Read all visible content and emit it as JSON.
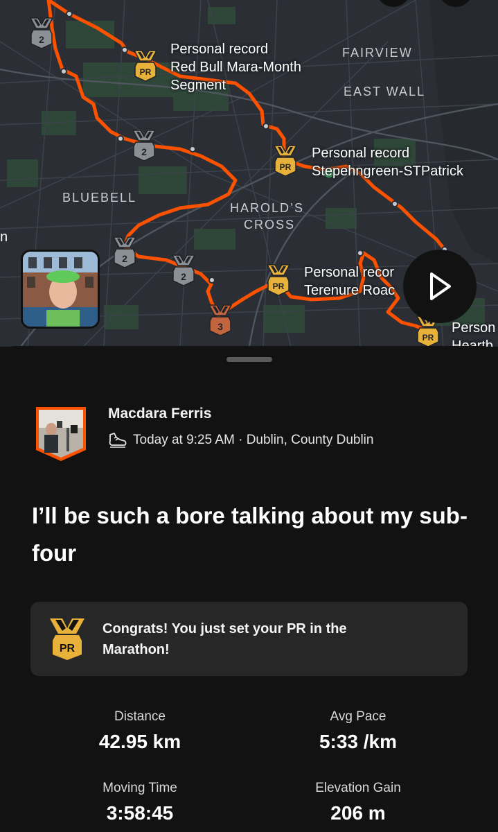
{
  "map": {
    "areas": [
      "FAIRVIEW",
      "EAST WALL",
      "BLUEBELL",
      "HAROLD’S",
      "CROSS",
      "n"
    ],
    "segments": [
      {
        "line1": "Personal record",
        "line2": "Red Bull Mara-Month",
        "line3": "Segment"
      },
      {
        "line1": "Personal record",
        "line2": "Stepehngreen-STPatrick"
      },
      {
        "line1": "Personal recor",
        "line2": "Terenure Roac"
      },
      {
        "line1": "Person",
        "line2": "Heartb"
      }
    ],
    "medals": [
      {
        "type": "silver",
        "rank": "2"
      },
      {
        "type": "gold",
        "rank": "PR"
      },
      {
        "type": "silver",
        "rank": "2"
      },
      {
        "type": "gold",
        "rank": "PR"
      },
      {
        "type": "silver",
        "rank": "2"
      },
      {
        "type": "silver",
        "rank": "2"
      },
      {
        "type": "gold",
        "rank": "PR"
      },
      {
        "type": "bronze",
        "rank": "3"
      },
      {
        "type": "gold",
        "rank": "PR"
      }
    ],
    "route_color": "#fc5200"
  },
  "activity": {
    "athlete_name": "Macdara Ferris",
    "sport_icon": "running-shoe-icon",
    "meta": "Today at 9:25 AM · Dublin, County Dublin",
    "title": "I’ll be such a bore talking about my sub-four",
    "pr_banner": {
      "icon": "pr-medal-icon",
      "rank": "PR",
      "text": "Congrats! You just set your PR in the Marathon!"
    },
    "stats": [
      {
        "label": "Distance",
        "value": "42.95 km"
      },
      {
        "label": "Avg Pace",
        "value": "5:33 /km"
      },
      {
        "label": "Moving Time",
        "value": "3:58:45"
      },
      {
        "label": "Elevation Gain",
        "value": "206 m"
      }
    ]
  },
  "colors": {
    "gold": "#e8b13a",
    "silver": "#8b9096",
    "bronze": "#c2643d",
    "background": "#121212",
    "card": "#272727"
  }
}
